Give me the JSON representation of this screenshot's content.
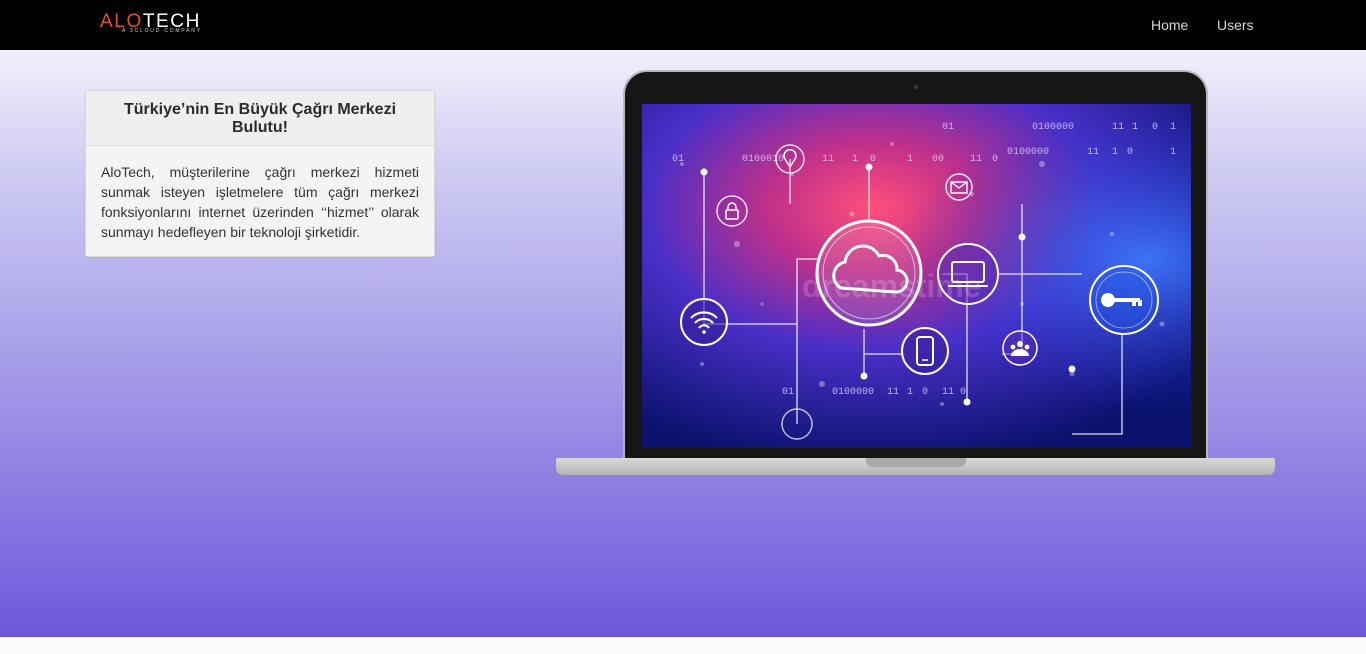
{
  "brand": {
    "logo_accent": "ALO",
    "logo_rest": "TECH",
    "logo_sub": "A 3CLOUD COMPANY",
    "accent_color": "#e74c3c"
  },
  "nav": {
    "home": "Home",
    "users": "Users"
  },
  "card": {
    "title": "Türkiye’nin En Büyük Çağrı Merkezi Bulutu!",
    "body": "AloTech, müşterilerine çağrı merkezi hizmeti sunmak isteyen işletmelere tüm çağrı merkezi fonksiyonlarını internet üzerinden ‘‘hizmet’’ olarak sunmayı hedefleyen bir teknoloji şirketidir."
  },
  "hero_image": {
    "watermark": "dreamstime",
    "icons": [
      "cloud-icon",
      "wifi-icon",
      "laptop-icon",
      "phone-icon",
      "key-icon",
      "lock-icon",
      "mail-icon",
      "users-icon",
      "location-icon"
    ],
    "binary": [
      "01",
      "0100010",
      "11",
      "1",
      "0",
      "1",
      "00",
      "11",
      "0",
      "0100000",
      "11",
      "1",
      "0",
      "1",
      "01",
      "0100000",
      "11",
      "1",
      "0",
      "1",
      "01",
      "0100000",
      "11",
      "1",
      "0",
      "11",
      "0"
    ]
  },
  "colors": {
    "navbar": "#000000",
    "hero_top": "#f1f0fb",
    "hero_bottom": "#6b59db"
  }
}
